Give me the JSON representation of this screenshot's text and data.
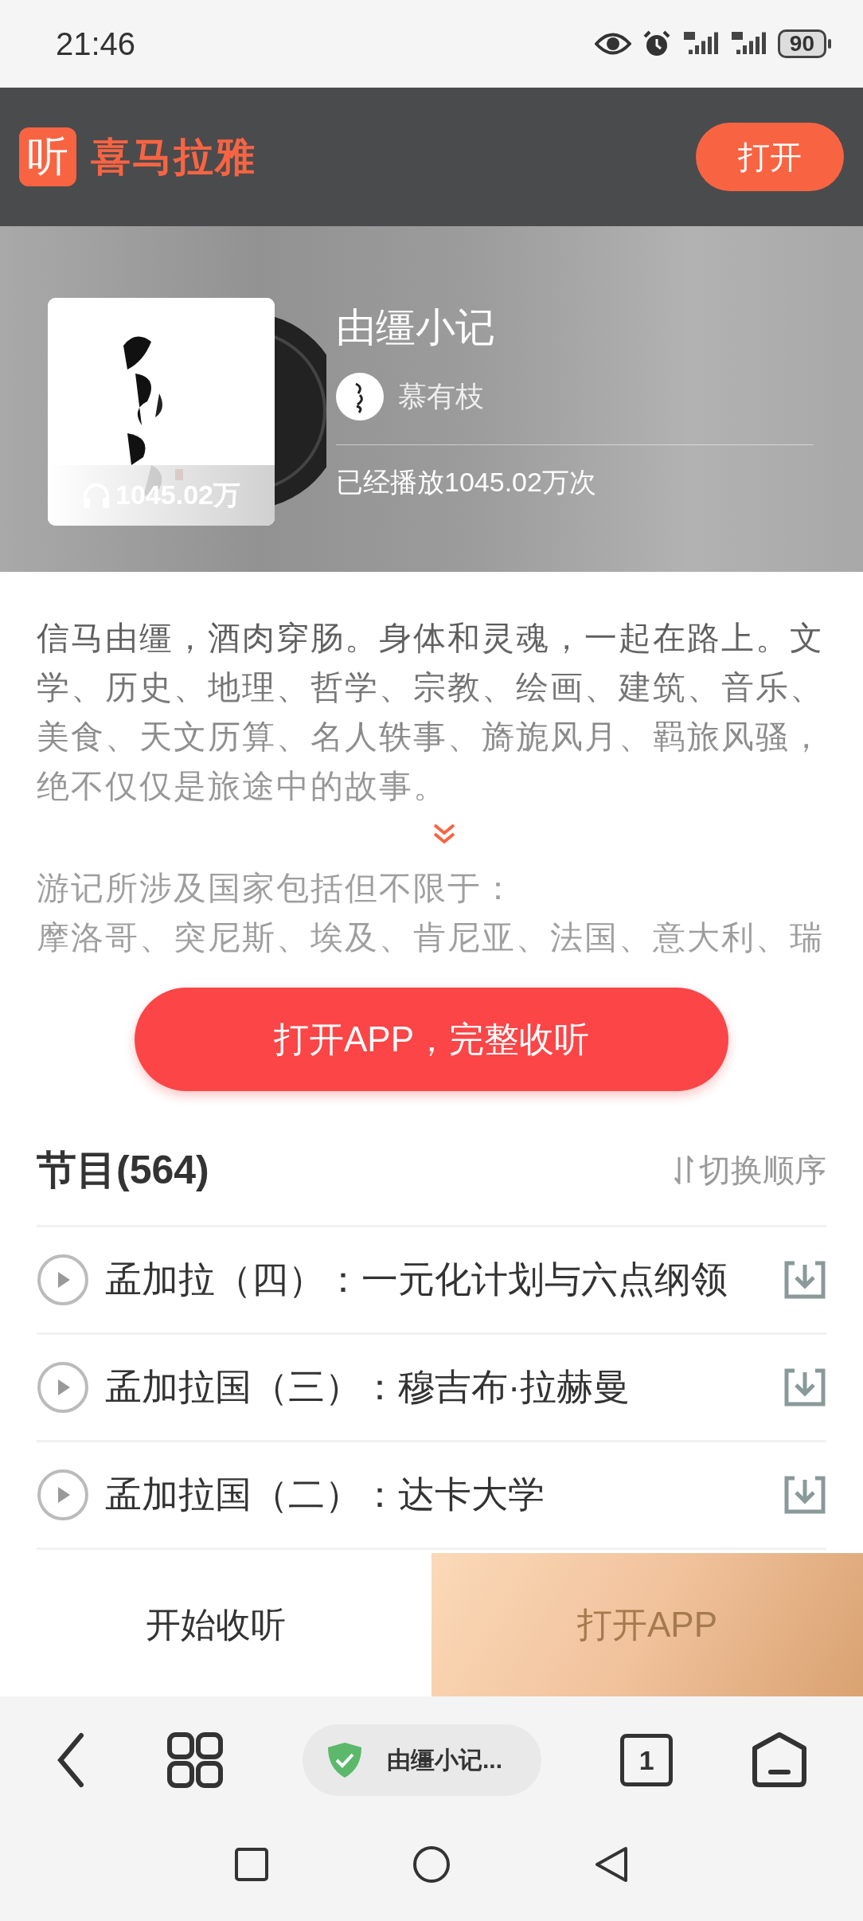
{
  "status_bar": {
    "time": "21:46",
    "battery": "90"
  },
  "header": {
    "logo_glyph": "听",
    "logo_text": "喜马拉雅",
    "open_button": "打开"
  },
  "album": {
    "title": "由缰小记",
    "author": "慕有枝",
    "cover_plays": "1045.02万",
    "plays": "已经播放1045.02万次"
  },
  "description": {
    "paragraphs": [
      "信马由缰，酒肉穿肠。身体和灵魂，一起在路上。文学、历史、地理、哲学、宗教、绘画、建筑、音乐、美食、天文历算、名人轶事、旖旎风月、羁旅风骚，绝不仅仅是旅途中的故事。",
      "游记所涉及国家包括但不限于：",
      "摩洛哥、突尼斯、埃及、肯尼亚、法国、意大利、瑞"
    ]
  },
  "cta_button": "打开APP，完整收听",
  "episodes": {
    "title": "节目(564)",
    "sort_button": "切换顺序",
    "items": [
      {
        "title": "孟加拉（四）：一元化计划与六点纲领"
      },
      {
        "title": "孟加拉国（三）：穆吉布·拉赫曼"
      },
      {
        "title": "孟加拉国（二）：达卡大学"
      }
    ]
  },
  "bottom_bar": {
    "listen_button": "开始收听",
    "open_app_button": "打开APP"
  },
  "browser_bar": {
    "tab_title": "由缰小记...",
    "tab_count": "1"
  }
}
